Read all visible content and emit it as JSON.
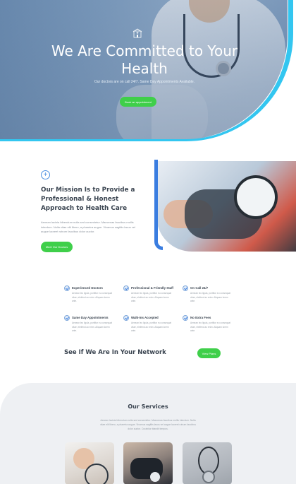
{
  "hero": {
    "title": "We Are Committed to Your Health",
    "subtitle": "Our doctors are on call 24/7. Same Day Appointments Available.",
    "button": "Book an appointment"
  },
  "mission": {
    "title": "Our Mission Is to Provide a Professional & Honest Approach to Health Care",
    "text": "Aenean lacinia bibendum nulla sed consectetur. Maecenas faucibus mollis interdum. Nulla vitae elit libero, a pharetra augue. Vivamus sagittis lacus vel augue laoreet rutrum faucibus dolor auctor.",
    "button": "Meet Our Doctors"
  },
  "features": [
    {
      "title": "Experienced Doctors",
      "text": "Aenean leo ligula, porttitor eu consequat vitae, eleifend ac enim. Aliquam lorem ante."
    },
    {
      "title": "Professional & Friendly Staff",
      "text": "Aenean leo ligula, porttitor eu consequat vitae, eleifend ac enim. Aliquam lorem ante."
    },
    {
      "title": "On Call 24/7",
      "text": "Aenean leo ligula, porttitor eu consequat vitae, eleifend ac enim. Aliquam lorem ante."
    },
    {
      "title": "Same Day Appointments",
      "text": "Aenean leo ligula, porttitor eu consequat vitae, eleifend ac enim. Aliquam lorem ante."
    },
    {
      "title": "Walk-Ins Accepted",
      "text": "Aenean leo ligula, porttitor eu consequat vitae, eleifend ac enim. Aliquam lorem ante."
    },
    {
      "title": "No Extra Fees",
      "text": "Aenean leo ligula, porttitor eu consequat vitae, eleifend ac enim. Aliquam lorem ante."
    }
  ],
  "network": {
    "title": "See If We Are In Your Network",
    "button": "View Plans"
  },
  "services": {
    "title": "Our Services",
    "text": "Aenean lacinia bibendum nulla sed consectetur. Maecenas faucibus mollis interdum. Nulla vitae elit libero, a pharetra augue. Vivamus sagittis lacus vel augue laoreet rutrum faucibus dolor auctor. Curabitur blandit tempus."
  },
  "colors": {
    "accent_green": "#3fcf4a",
    "accent_blue": "#3a7de0",
    "hero_ring": "#33c6f0"
  }
}
